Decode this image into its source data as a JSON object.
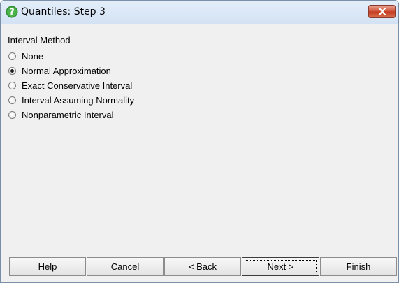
{
  "window": {
    "title": "Quantiles: Step 3",
    "title_icon": "help-question-icon",
    "close_icon": "close-x-icon"
  },
  "interval_method": {
    "label": "Interval Method",
    "options": [
      {
        "label": "None",
        "selected": false
      },
      {
        "label": "Normal Approximation",
        "selected": true
      },
      {
        "label": "Exact Conservative Interval",
        "selected": false
      },
      {
        "label": "Interval Assuming Normality",
        "selected": false
      },
      {
        "label": "Nonparametric Interval",
        "selected": false
      }
    ]
  },
  "buttons": {
    "help": "Help",
    "cancel": "Cancel",
    "back": "< Back",
    "next": "Next >",
    "finish": "Finish"
  },
  "colors": {
    "dialog_bg": "#f0f0f0",
    "title_icon": "#3a9a3a",
    "close_button": "#c9462c"
  }
}
